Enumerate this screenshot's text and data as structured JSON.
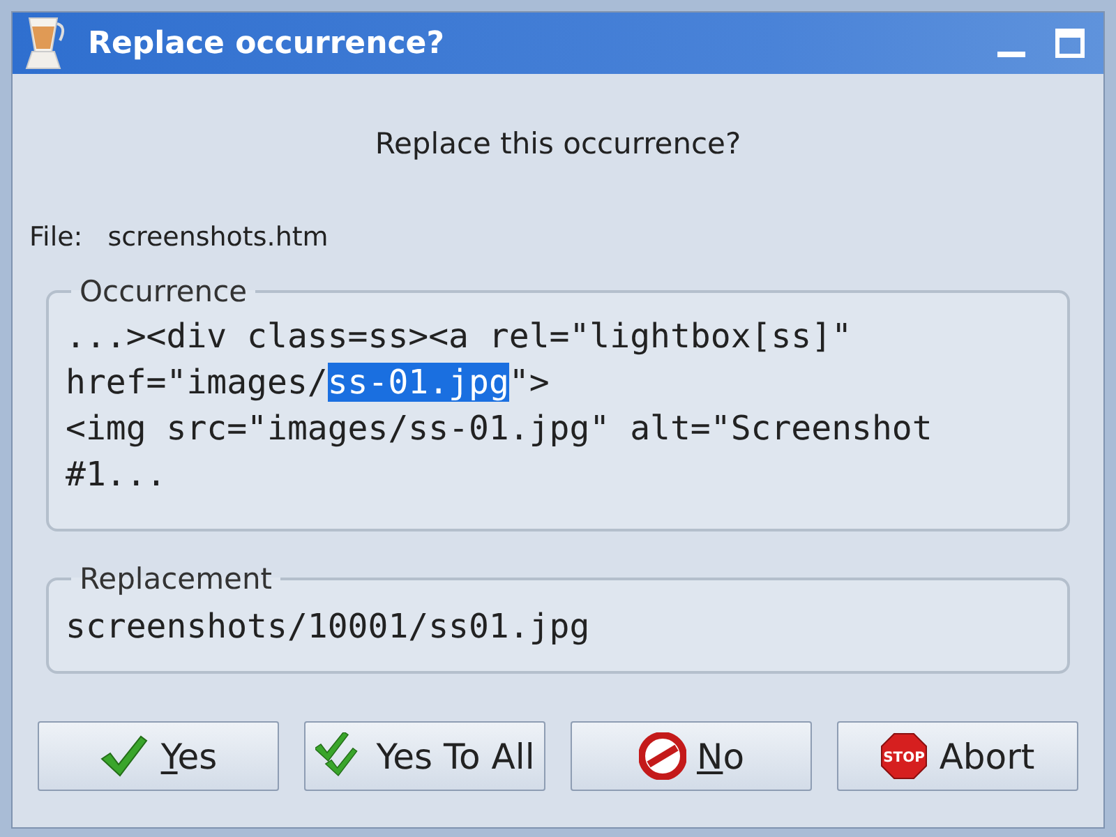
{
  "window": {
    "title": "Replace occurrence?"
  },
  "prompt": "Replace this occurrence?",
  "file": {
    "label": "File:",
    "value": "screenshots.htm"
  },
  "occurrence": {
    "title": "Occurrence",
    "lines": [
      [
        {
          "text": "...><div class=ss><a rel=\"lightbox[ss]\"",
          "selected": false
        }
      ],
      [
        {
          "text": "href=\"images/",
          "selected": false
        },
        {
          "text": "ss-01.jpg",
          "selected": true
        },
        {
          "text": "\">",
          "selected": false
        }
      ],
      [
        {
          "text": "<img src=\"images/ss-01.jpg\" alt=\"Screenshot",
          "selected": false
        }
      ],
      [
        {
          "text": "#1...",
          "selected": false
        }
      ]
    ]
  },
  "replacement": {
    "title": "Replacement",
    "value": "screenshots/10001/ss01.jpg"
  },
  "buttons": [
    {
      "kind": "check",
      "key": "Y",
      "rest": "es"
    },
    {
      "kind": "double-check",
      "rest": "Yes To All"
    },
    {
      "kind": "no",
      "key": "N",
      "rest": "o"
    },
    {
      "kind": "stop",
      "rest": "Abort",
      "icon_text": "STOP"
    }
  ]
}
